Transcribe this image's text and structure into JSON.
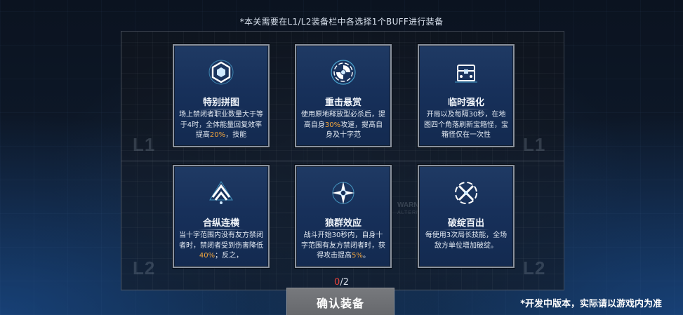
{
  "notice": "*本关需要在L1/L2装备栏中各选择1个BUFF进行装备",
  "rows": {
    "l1_label_left": "L1",
    "l1_label_right": "L1",
    "l2_label_left": "L2",
    "l2_label_right": "L2"
  },
  "watermark": {
    "line1": "WARNING",
    "line2": "ALTERNATE SIG"
  },
  "cards": [
    {
      "title": "特别拼图",
      "icon": "hex-puzzle-icon",
      "desc_pre": "场上禁闭者职业数量大于等于4时，全体能量回复效率提高",
      "desc_hl": "20%",
      "desc_post": "，技能"
    },
    {
      "title": "重击悬赏",
      "icon": "spiral-target-icon",
      "desc_pre": "使用原地释放型必杀后，提高自身",
      "desc_hl": "30%",
      "desc_post": "攻速，提高自身及十字范"
    },
    {
      "title": "临时强化",
      "icon": "treasure-chest-icon",
      "desc_pre": "开局以及每隔30秒，在地图四个角落刷新宝箱怪，宝箱怪仅在一次性",
      "desc_hl": "",
      "desc_post": ""
    },
    {
      "title": "合纵连横",
      "icon": "chevron-emblem-icon",
      "desc_pre": "当十字范围内没有友方禁闭者时，禁闭者受到伤害降低",
      "desc_hl": "40%",
      "desc_post": "；反之，"
    },
    {
      "title": "狼群效应",
      "icon": "crosshair-star-icon",
      "desc_pre": "战斗开始30秒内，自身十字范围有友方禁闭者时，获得攻击提高",
      "desc_hl": "5%",
      "desc_post": "。"
    },
    {
      "title": "破绽百出",
      "icon": "shattered-x-icon",
      "desc_pre": "每使用3次局长技能，全场敌方单位增加破绽。",
      "desc_hl": "",
      "desc_post": ""
    }
  ],
  "counter": {
    "current": "0",
    "total": "/2"
  },
  "confirm_label": "确认装备",
  "footnote": "*开发中版本，实际请以游戏内为准",
  "colors": {
    "highlight": "#f1a53c",
    "counter_current": "#e4413a",
    "card_bg": "#17305a",
    "icon_glow": "#5fd3ff"
  }
}
